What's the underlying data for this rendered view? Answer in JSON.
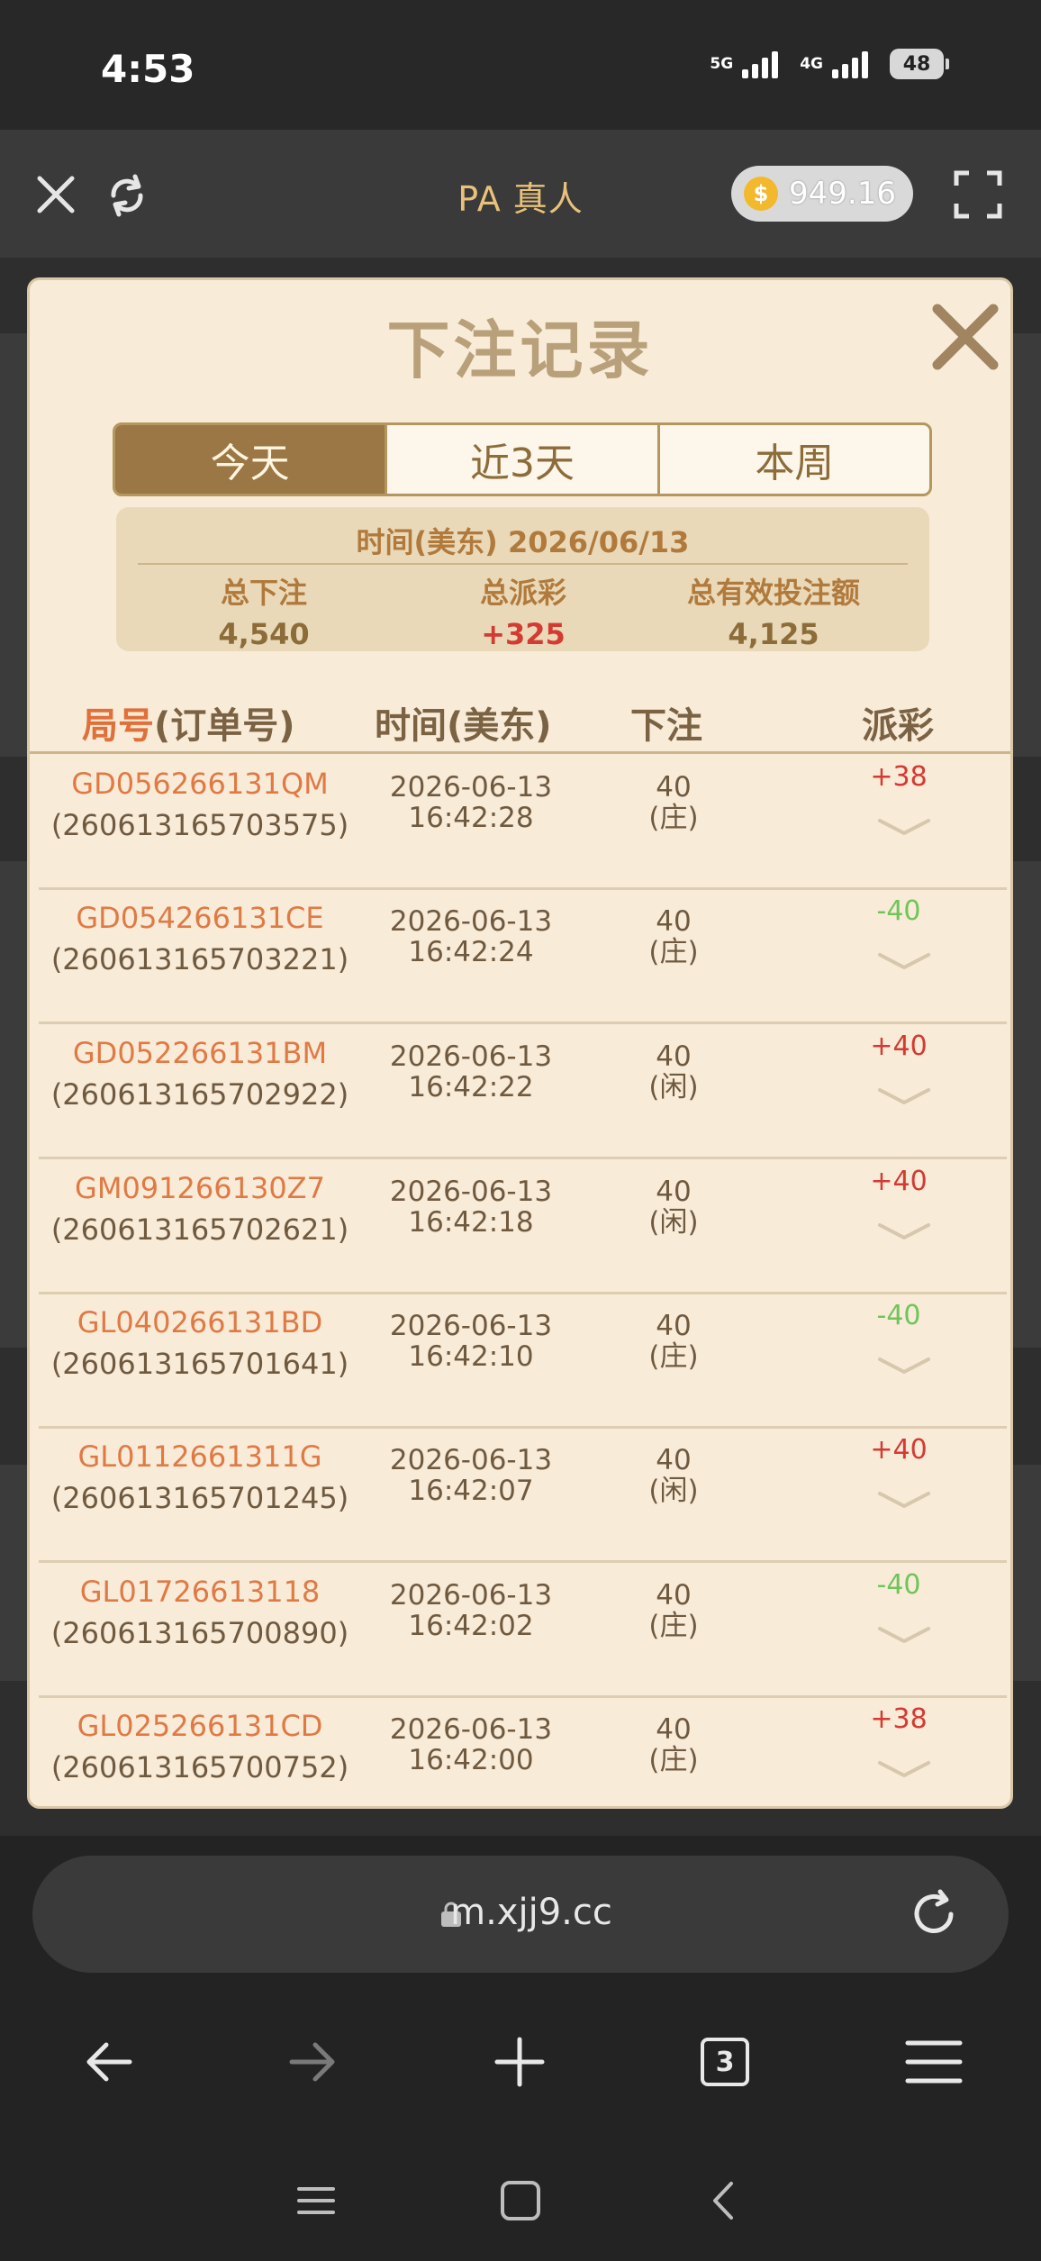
{
  "status_bar": {
    "time": "4:53",
    "network1": "5G",
    "network2": "4G",
    "battery": "48"
  },
  "header": {
    "title": "PA 真人",
    "balance": "949.16",
    "coin_symbol": "$"
  },
  "modal": {
    "title": "下注记录",
    "tabs": [
      {
        "label": "今天",
        "active": true
      },
      {
        "label": "近3天",
        "active": false
      },
      {
        "label": "本周",
        "active": false
      }
    ],
    "summary": {
      "time": "时间(美东) 2026/06/13",
      "total_bet_label": "总下注",
      "total_bet": "4,540",
      "total_payout_label": "总派彩",
      "total_payout": "+325",
      "total_valid_label": "总有效投注额",
      "total_valid": "4,125"
    },
    "columns": {
      "id_prefix": "局号",
      "id_suffix": "(订单号)",
      "time": "时间(美东)",
      "bet": "下注",
      "payout": "派彩"
    },
    "rows": [
      {
        "code": "GD056266131QM",
        "order": "(260613165703575)",
        "date": "2026-06-13",
        "time": "16:42:28",
        "bet": "40",
        "side": "(庄)",
        "payout": "+38"
      },
      {
        "code": "GD054266131CE",
        "order": "(260613165703221)",
        "date": "2026-06-13",
        "time": "16:42:24",
        "bet": "40",
        "side": "(庄)",
        "payout": "-40"
      },
      {
        "code": "GD052266131BM",
        "order": "(260613165702922)",
        "date": "2026-06-13",
        "time": "16:42:22",
        "bet": "40",
        "side": "(闲)",
        "payout": "+40"
      },
      {
        "code": "GM091266130Z7",
        "order": "(260613165702621)",
        "date": "2026-06-13",
        "time": "16:42:18",
        "bet": "40",
        "side": "(闲)",
        "payout": "+40"
      },
      {
        "code": "GL040266131BD",
        "order": "(260613165701641)",
        "date": "2026-06-13",
        "time": "16:42:10",
        "bet": "40",
        "side": "(庄)",
        "payout": "-40"
      },
      {
        "code": "GL0112661311G",
        "order": "(260613165701245)",
        "date": "2026-06-13",
        "time": "16:42:07",
        "bet": "40",
        "side": "(闲)",
        "payout": "+40"
      },
      {
        "code": "GL01726613118",
        "order": "(260613165700890)",
        "date": "2026-06-13",
        "time": "16:42:02",
        "bet": "40",
        "side": "(庄)",
        "payout": "-40"
      },
      {
        "code": "GL025266131CD",
        "order": "(260613165700752)",
        "date": "2026-06-13",
        "time": "16:42:00",
        "bet": "40",
        "side": "(庄)",
        "payout": "+38"
      }
    ]
  },
  "browser": {
    "url": "m.xjj9.cc",
    "tab_count": "3"
  },
  "colors": {
    "positive": "#d33a32",
    "negative": "#71c45a",
    "accent": "#9a7744"
  }
}
